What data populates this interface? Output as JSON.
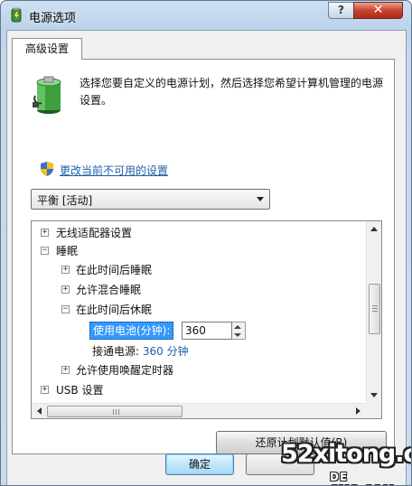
{
  "window": {
    "title": "电源选项",
    "help_button": "?",
    "close_button": "✕"
  },
  "tab": {
    "label": "高级设置"
  },
  "description": "选择您要自定义的电源计划，然后选择您希望计算机管理的电源设置。",
  "change_link": "更改当前不可用的设置",
  "plan_select": {
    "value": "平衡 [活动]"
  },
  "tree": {
    "items": [
      {
        "label": "无线适配器设置",
        "expander": "+"
      },
      {
        "label": "睡眠",
        "expander": "−"
      },
      {
        "label": "在此时间后睡眠",
        "expander": "+"
      },
      {
        "label": "允许混合睡眠",
        "expander": "+"
      },
      {
        "label": "在此时间后休眠",
        "expander": "−"
      },
      {
        "label": "允许使用唤醒定时器",
        "expander": "+"
      },
      {
        "label": "USB 设置",
        "expander": "+"
      }
    ],
    "battery_setting": {
      "label": "使用电池(分钟):",
      "value": "360"
    },
    "ac_setting": {
      "label": "接通电源:",
      "value": "360 分钟"
    }
  },
  "restore_button": "还原计划默认值(R)",
  "buttons": {
    "ok": "确定",
    "cancel": ""
  },
  "watermark": {
    "main": "52xitong.com",
    "sub": "DE CMS.COM"
  },
  "colors": {
    "link": "#1f5fa8",
    "selection": "#3399ff",
    "close": "#c9442f"
  }
}
